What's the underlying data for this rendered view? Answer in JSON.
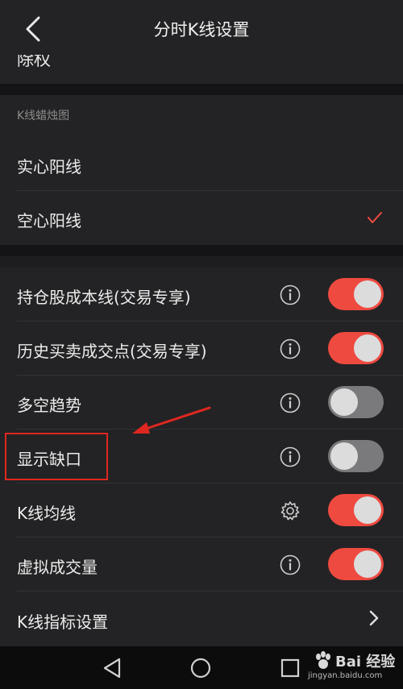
{
  "header": {
    "title": "分时K线设置"
  },
  "partial_row": {
    "label": "除权"
  },
  "candle_section": {
    "label": "K线蜡烛图",
    "options": [
      {
        "label": "实心阳线",
        "selected": false
      },
      {
        "label": "空心阳线",
        "selected": true
      }
    ]
  },
  "settings": [
    {
      "label": "持仓股成本线(交易专享)",
      "icon": "info-icon",
      "toggle": "on"
    },
    {
      "label": "历史买卖成交点(交易专享)",
      "icon": "info-icon",
      "toggle": "on"
    },
    {
      "label": "多空趋势",
      "icon": "info-icon",
      "toggle": "off"
    },
    {
      "label": "显示缺口",
      "icon": "info-icon",
      "toggle": "off"
    },
    {
      "label": "K线均线",
      "icon": "gear-icon",
      "toggle": "on"
    },
    {
      "label": "虚拟成交量",
      "icon": "info-icon",
      "toggle": "on"
    }
  ],
  "indicator_row": {
    "label": "K线指标设置"
  },
  "watermark": {
    "brand": "Bai 经验",
    "url": "jingyan.baidu.com"
  },
  "colors": {
    "accent": "#ef4a40",
    "toggle_off": "#7a7a7c",
    "annotation": "#e0271f"
  }
}
